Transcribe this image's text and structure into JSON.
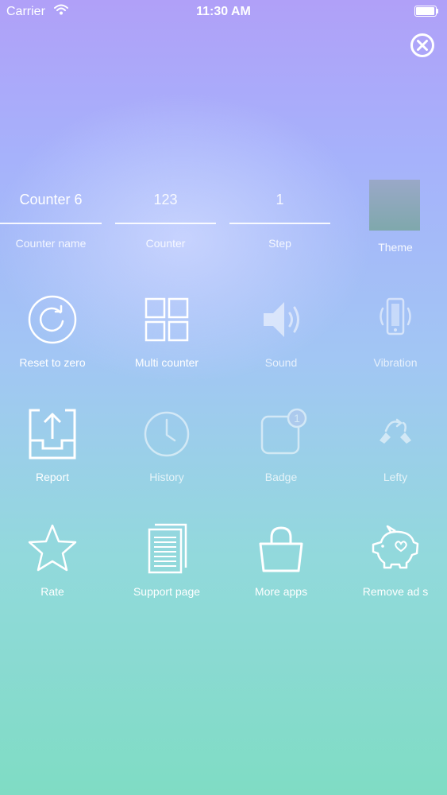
{
  "status_bar": {
    "carrier": "Carrier",
    "time": "11:30 AM"
  },
  "fields": {
    "counter_name": {
      "value": "Counter 6",
      "label": "Counter name"
    },
    "counter": {
      "value": "123",
      "label": "Counter"
    },
    "step": {
      "value": "1",
      "label": "Step"
    }
  },
  "theme": {
    "label": "Theme",
    "color": "#8aa5b8"
  },
  "menu": [
    {
      "label": "Reset to zero",
      "icon": "reset-icon"
    },
    {
      "label": "Multi counter",
      "icon": "grid-icon"
    },
    {
      "label": "Sound",
      "icon": "speaker-icon"
    },
    {
      "label": "Vibration",
      "icon": "vibration-icon"
    },
    {
      "label": "Report",
      "icon": "export-icon"
    },
    {
      "label": "History",
      "icon": "clock-icon"
    },
    {
      "label": "Badge",
      "icon": "badge-icon",
      "badge_count": "1"
    },
    {
      "label": "Lefty",
      "icon": "hands-icon"
    },
    {
      "label": "Rate",
      "icon": "star-icon"
    },
    {
      "label": "Support page",
      "icon": "document-icon"
    },
    {
      "label": "More apps",
      "icon": "shopping-bag-icon"
    },
    {
      "label": "Remove ad s",
      "icon": "piggy-bank-icon"
    }
  ]
}
